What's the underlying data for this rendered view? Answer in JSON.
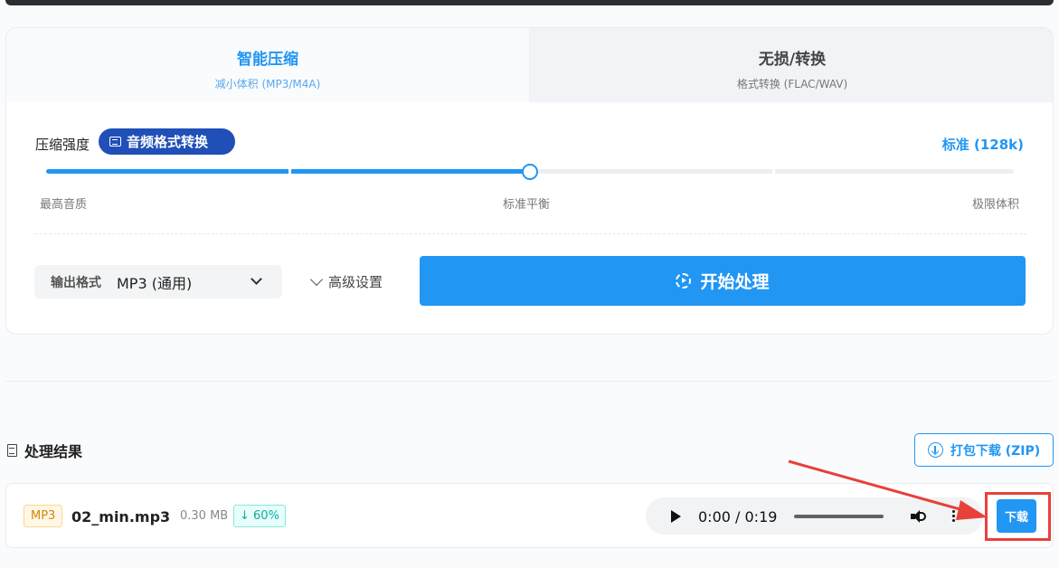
{
  "tabs": [
    {
      "title": "智能压缩",
      "subtitle": "减小体积 (MP3/M4A)"
    },
    {
      "title": "无损/转换",
      "subtitle": "格式转换 (FLAC/WAV)"
    }
  ],
  "compression": {
    "label": "压缩强度",
    "pill_label": "音频格式转换",
    "value_label": "标准 (128k)",
    "slider_level": 0.5,
    "scale_labels": {
      "left": "最高音质",
      "middle": "标准平衡",
      "right": "极限体积"
    }
  },
  "output": {
    "label": "输出格式",
    "value": "MP3 (通用)"
  },
  "advanced_label": "高级设置",
  "start_button": "开始处理",
  "results": {
    "title": "处理结果",
    "zip_button": "打包下载 (ZIP)",
    "items": [
      {
        "format": "MP3",
        "filename": "02_min.mp3",
        "size": "0.30 MB",
        "ratio": "↓ 60%",
        "player_time": "0:00 / 0:19",
        "download_label": "下载"
      }
    ]
  },
  "colors": {
    "accent": "#2196f3",
    "annotation": "#e8403b",
    "pill": "#1f4fb7"
  },
  "icons": [
    "format-convert-icon",
    "chevron-down-icon",
    "spinner-icon",
    "document-icon",
    "download-circle-icon",
    "play-icon",
    "volume-icon",
    "more-icon"
  ]
}
